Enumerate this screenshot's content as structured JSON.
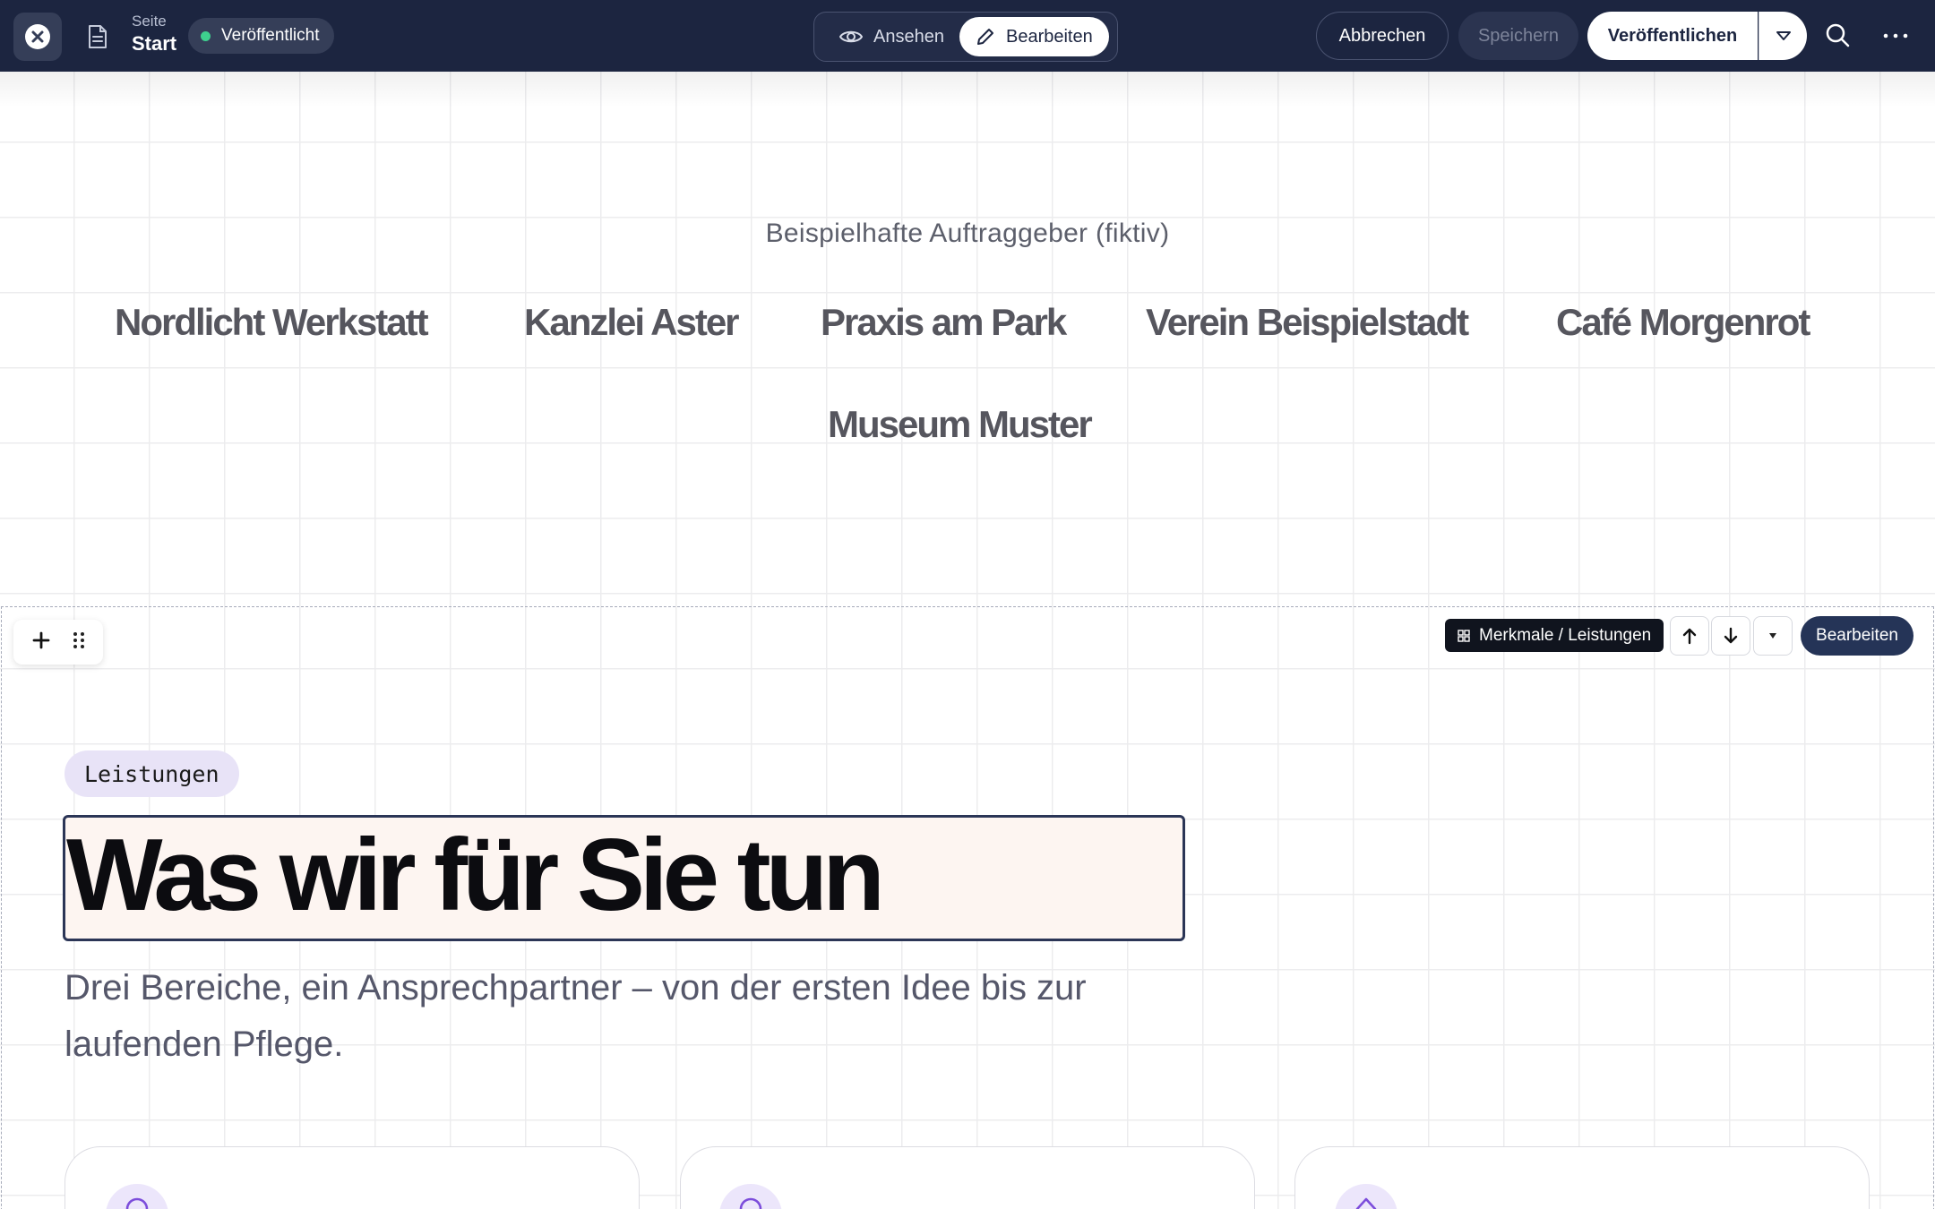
{
  "topbar": {
    "close_icon": "close-circle-icon",
    "page_type_label": "Seite",
    "page_name": "Start",
    "status_label": "Veröffentlicht",
    "status_color": "#3ecf8e",
    "mode_view_label": "Ansehen",
    "mode_edit_label": "Bearbeiten",
    "cancel_label": "Abbrechen",
    "save_label": "Speichern",
    "publish_label": "Veröffentlichen"
  },
  "clients": {
    "heading": "Beispielhafte Auftraggeber (fiktiv)",
    "logos": [
      "Nordlicht Werkstatt",
      "Kanzlei Aster",
      "Praxis am Park",
      "Verein Beispielstadt",
      "Café Morgenrot",
      "Museum Muster"
    ]
  },
  "section_toolbar": {
    "type_label": "Merkmale / Leistungen",
    "edit_label": "Bearbeiten"
  },
  "features": {
    "badge": "Leistungen",
    "heading": "Was wir für Sie tun",
    "lead": "Drei Bereiche, ein Ansprechpartner – von der ersten Idee bis zur laufenden Pflege."
  },
  "colors": {
    "topbar_bg": "#1c2540",
    "accent_dark": "#253457",
    "badge_bg": "#e8e3f7",
    "icon_accent": "#7c4ddb"
  }
}
